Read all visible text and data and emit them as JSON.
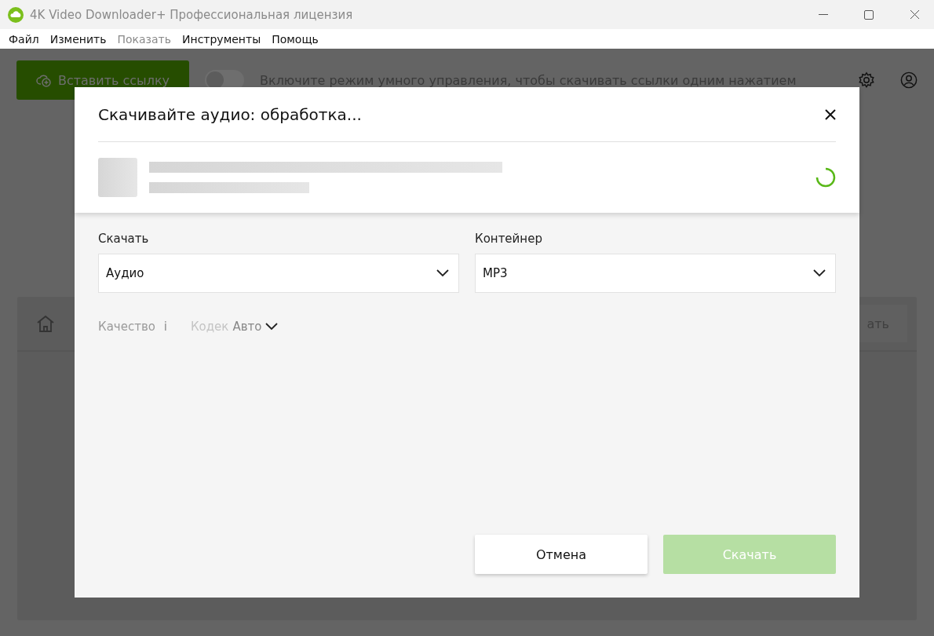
{
  "window": {
    "title": "4K Video Downloader+ Профессиональная лицензия"
  },
  "menu": [
    {
      "label": "Файл",
      "disabled": false
    },
    {
      "label": "Изменить",
      "disabled": false
    },
    {
      "label": "Показать",
      "disabled": true
    },
    {
      "label": "Инструменты",
      "disabled": false
    },
    {
      "label": "Помощь",
      "disabled": false
    }
  ],
  "toolbar": {
    "paste_button": "Вставить ссылку",
    "smart_mode": {
      "on": false,
      "hint": "Включите режим умного управления, чтобы скачивать ссылки одним нажатием"
    }
  },
  "panel": {
    "button_fragment": "ать"
  },
  "dialog": {
    "title": "Скачивайте аудио: обработка...",
    "fields": [
      {
        "label": "Скачать",
        "value": "Аудио"
      },
      {
        "label": "Контейнер",
        "value": "MP3"
      }
    ],
    "quality": {
      "label": "Качество",
      "info": "i"
    },
    "codec": {
      "label": "Кодек",
      "value": "Авто"
    },
    "buttons": [
      {
        "label": "Отмена",
        "kind": "secondary",
        "disabled": false
      },
      {
        "label": "Скачать",
        "kind": "primary",
        "disabled": true
      }
    ]
  }
}
